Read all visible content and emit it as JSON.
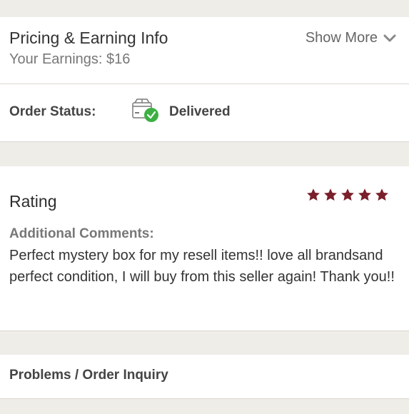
{
  "pricing": {
    "title": "Pricing & Earning Info",
    "earnings": "Your Earnings: $16",
    "show_more_label": "Show More"
  },
  "order_status": {
    "label": "Order Status:",
    "value": "Delivered",
    "icon": "package-delivered-icon",
    "check_color": "#3cb043"
  },
  "rating": {
    "title": "Rating",
    "stars": 5,
    "max_stars": 5,
    "star_color": "#7a1f2b",
    "comments_label": "Additional Comments:",
    "comments_text": "Perfect mystery box for my resell items!! love all brandsand perfect condition, I will buy from this seller again! Thank you!!"
  },
  "problems": {
    "label": "Problems / Order Inquiry"
  },
  "colors": {
    "background": "#efede8",
    "card": "#ffffff",
    "divider": "#d9d6d0"
  }
}
